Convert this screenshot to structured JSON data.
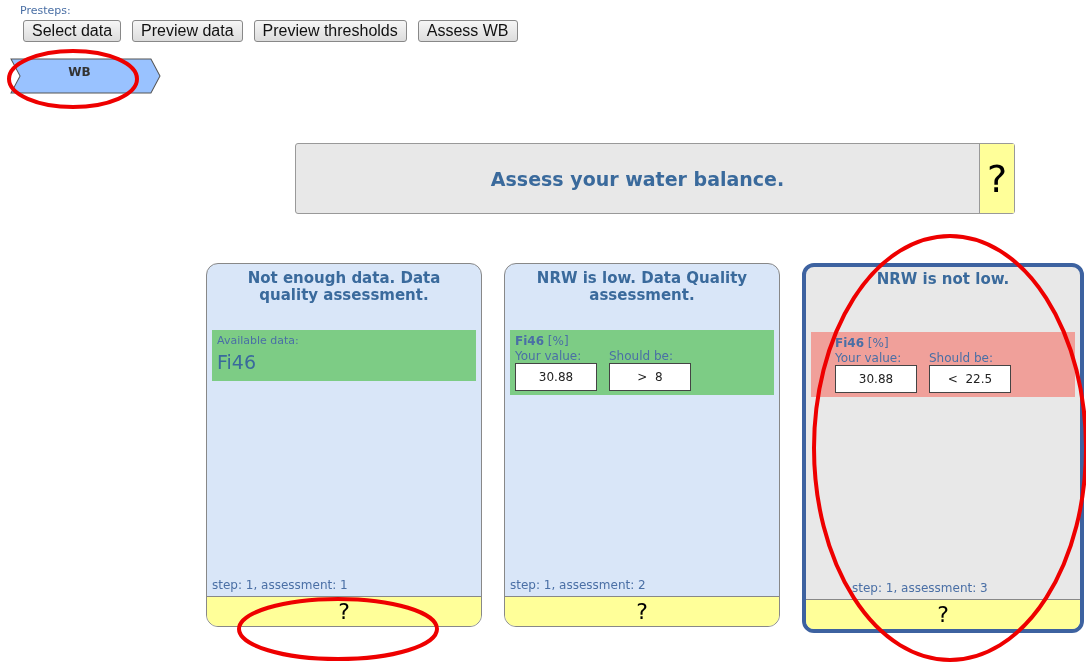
{
  "presteps": {
    "label": "Presteps:",
    "buttons": [
      "Select data",
      "Preview data",
      "Preview thresholds",
      "Assess WB"
    ]
  },
  "steps": [
    {
      "label": "WB",
      "selected": true
    }
  ],
  "header": {
    "text": "Assess your water balance.",
    "help": "?"
  },
  "cards": [
    {
      "title": "Not enough data. Data quality assessment.",
      "selected": false,
      "kind": "available",
      "caption": "Available data:",
      "value": "Fi46",
      "passed": true,
      "footer": "step: 1, assessment: 1",
      "help": "?"
    },
    {
      "title": "NRW is low. Data Quality assessment.",
      "selected": false,
      "kind": "comparison",
      "indicator": "Fi46",
      "unit": "[%]",
      "value_label": "Your value:",
      "target_label": "Should be:",
      "value": "30.88",
      "target": ">  8",
      "passed": true,
      "footer": "step: 1, assessment: 2",
      "help": "?"
    },
    {
      "title": "NRW is not low.",
      "selected": true,
      "kind": "comparison",
      "indicator": "Fi46",
      "unit": "[%]",
      "value_label": "Your value:",
      "target_label": "Should be:",
      "value": "30.88",
      "target": "<  22.5",
      "passed": false,
      "footer": "step: 1, assessment: 3",
      "help": "?"
    }
  ]
}
